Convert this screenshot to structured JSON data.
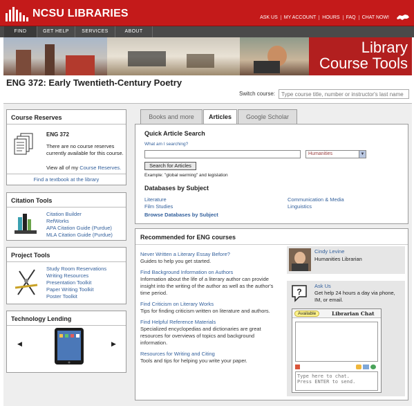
{
  "header": {
    "logo_text": "NCSU LIBRARIES",
    "top_links": [
      "ASK US",
      "MY ACCOUNT",
      "HOURS",
      "FAQ",
      "CHAT NOW!"
    ]
  },
  "nav": {
    "items": [
      "FIND",
      "GET HELP",
      "SERVICES",
      "ABOUT"
    ]
  },
  "banner": {
    "title_line1": "Library",
    "title_line2": "Course Tools"
  },
  "course": {
    "title": "ENG 372: Early Twentieth-Century Poetry",
    "switch_label": "Switch course:",
    "switch_placeholder": "Type course title, number or instructor's last name"
  },
  "reserves": {
    "heading": "Course Reserves",
    "course": "ENG 372",
    "message": "There are no course reserves currently available for this course.",
    "view_prefix": "View all of my ",
    "view_link": "Course Reserves.",
    "footer_link": "Find a textbook at the library"
  },
  "citation": {
    "heading": "Citation Tools",
    "links": [
      "Citation Builder",
      "RefWorks",
      "APA Citation Guide (Purdue)",
      "MLA Citation Guide (Purdue)"
    ]
  },
  "project": {
    "heading": "Project Tools",
    "links": [
      "Study Room Reservations",
      "Writing Resources",
      "Presentation Toolkit",
      "Paper Writing Toolkit",
      "Poster Toolkit"
    ]
  },
  "tech": {
    "heading": "Technology Lending",
    "prev": "◀",
    "next": "▶"
  },
  "tabs": [
    "Books and more",
    "Articles",
    "Google Scholar"
  ],
  "search": {
    "title": "Quick Article Search",
    "help_link": "What am I searching?",
    "query_value": "",
    "subject_selected": "Humanities",
    "select_arrow": "▼",
    "button": "Search for Articles",
    "example": "Example: \"global warming\" and legislation",
    "db_title": "Databases by Subject",
    "db_links": [
      "Literature",
      "Film Studies",
      "Communication & Media",
      "Linguistics"
    ],
    "browse_link": "Browse Databases by Subject"
  },
  "recommended": {
    "heading": "Recommended for ENG courses",
    "items": [
      {
        "title": "Never Written a Literary Essay Before?",
        "desc": "Guides to help you get started."
      },
      {
        "title": "Find Background Information on Authors",
        "desc": "Information about the life of a literary author can provide insight into the writing of the author as well as the author's time period."
      },
      {
        "title": "Find Criticism on Literary Works",
        "desc": "Tips for finding criticism written on literature and authors."
      },
      {
        "title": "Find Helpful Reference Materials",
        "desc": "Specialized encyclopedias and dictionaries are great resources for overviews of topics and background information."
      },
      {
        "title": "Resources for Writing and Citing",
        "desc": "Tools and tips for helping you write your paper."
      }
    ]
  },
  "librarian": {
    "name": "Cindy Levine",
    "role": "Humanities Librarian"
  },
  "askus": {
    "title": "Ask Us",
    "text": "Get help 24 hours a day via phone, IM, or email.",
    "chat_status": "Available",
    "chat_title": "Librarian Chat",
    "chat_placeholder": "Type here to chat.\nPress ENTER to send."
  },
  "colors": {
    "brand_red": "#c41a1a",
    "nav_gray": "#4a4a4a",
    "link_blue": "#33609c"
  }
}
